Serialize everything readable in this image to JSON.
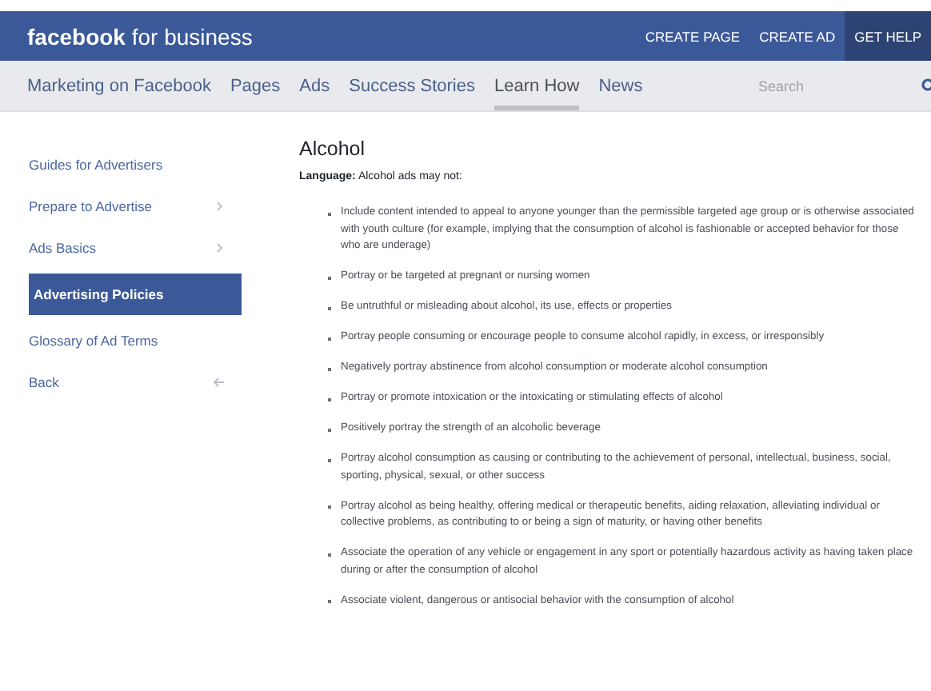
{
  "header": {
    "logo": "**facebook** for business",
    "links": [
      {
        "label": "CREATE PAGE",
        "selected": false
      },
      {
        "label": "CREATE AD",
        "selected": false
      },
      {
        "label": "GET HELP",
        "selected": true
      }
    ]
  },
  "nav": {
    "tabs": [
      {
        "label": "Marketing on Facebook",
        "selected": false
      },
      {
        "label": "Pages",
        "selected": false
      },
      {
        "label": "Ads",
        "selected": false
      },
      {
        "label": "Success Stories",
        "selected": false
      },
      {
        "label": "Learn How",
        "selected": true
      },
      {
        "label": "News",
        "selected": false
      }
    ],
    "search": {
      "placeholder": "Search"
    }
  },
  "sidebar": {
    "items": [
      {
        "label": "Guides for Advertisers",
        "kind": "link",
        "selected": false
      },
      {
        "label": "Prepare to Advertise",
        "kind": "submenu",
        "selected": false
      },
      {
        "label": "Ads Basics",
        "kind": "submenu",
        "selected": false
      },
      {
        "label": "Advertising Policies",
        "kind": "link",
        "selected": true
      },
      {
        "label": "Glossary of Ad Terms",
        "kind": "link",
        "selected": false
      },
      {
        "label": "Back",
        "kind": "back",
        "selected": false
      }
    ]
  },
  "article": {
    "title": "Alcohol",
    "intro": "**Language:** Alcohol ads may not:",
    "items": [
      "Include content intended to appeal to anyone younger than the permissible targeted age group or is otherwise associated with youth culture (for example, implying that the consumption of alcohol is fashionable or accepted behavior for those who are underage)",
      "Portray or be targeted at pregnant or nursing women",
      "Be untruthful or misleading about alcohol, its use, effects or properties",
      "Portray people consuming or encourage people to consume alcohol rapidly, in excess, or irresponsibly",
      "Negatively portray abstinence from alcohol consumption or moderate alcohol consumption",
      "Portray or promote intoxication or the intoxicating or stimulating effects of alcohol",
      "Positively portray the strength of an alcoholic beverage",
      "Portray alcohol consumption as causing or contributing to the achievement of personal, intellectual, business, social, sporting, physical, sexual, or other success",
      "Portray alcohol as being healthy, offering medical or therapeutic benefits, aiding relaxation, alleviating individual or collective problems, as contributing to or being a sign of maturity, or having other benefits",
      "Associate the operation of any vehicle or engagement in any sport or potentially hazardous activity as having taken place during or after the consumption of alcohol",
      "Associate violent, dangerous or antisocial behavior with the consumption of alcohol"
    ]
  }
}
